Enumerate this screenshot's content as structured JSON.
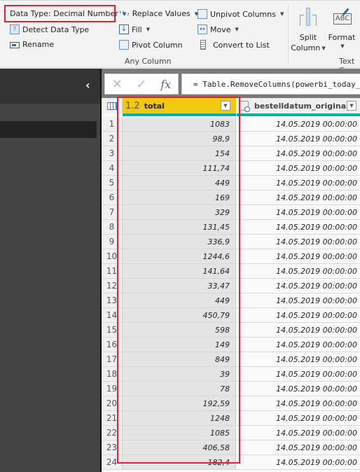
{
  "ribbon": {
    "data_type_label": "Data Type: Decimal Number",
    "detect_data_type": "Detect Data Type",
    "rename": "Rename",
    "replace_values": "Replace Values",
    "fill": "Fill",
    "pivot_column": "Pivot Column",
    "unpivot_columns": "Unpivot Columns",
    "move": "Move",
    "convert_to_list": "Convert to List",
    "group_any_column": "Any Column",
    "split_column_line1": "Split",
    "split_column_line2": "Column",
    "format": "Format",
    "group_text_column": "Text C",
    "highlight_color": "#e02230"
  },
  "formula_bar": {
    "cancel_icon": "✕",
    "commit_icon": "✓",
    "fx_label": "fx",
    "formula": "= Table.RemoveColumns(powerbi_today_"
  },
  "sidebar": {
    "collapse_icon": "‹"
  },
  "grid": {
    "columns": [
      {
        "type_label": "1.2",
        "name": "total",
        "header_color": "#f2c811"
      },
      {
        "type_label": "datetime",
        "name": "bestelldatum_original"
      }
    ],
    "rows": [
      {
        "n": "1",
        "total": "1083",
        "date": "14.05.2019 00:00:00"
      },
      {
        "n": "2",
        "total": "98,9",
        "date": "14.05.2019 00:00:00"
      },
      {
        "n": "3",
        "total": "154",
        "date": "14.05.2019 00:00:00"
      },
      {
        "n": "4",
        "total": "111,74",
        "date": "14.05.2019 00:00:00"
      },
      {
        "n": "5",
        "total": "449",
        "date": "14.05.2019 00:00:00"
      },
      {
        "n": "6",
        "total": "169",
        "date": "14.05.2019 00:00:00"
      },
      {
        "n": "7",
        "total": "329",
        "date": "14.05.2019 00:00:00"
      },
      {
        "n": "8",
        "total": "131,45",
        "date": "14.05.2019 00:00:00"
      },
      {
        "n": "9",
        "total": "336,9",
        "date": "14.05.2019 00:00:00"
      },
      {
        "n": "10",
        "total": "1244,6",
        "date": "14.05.2019 00:00:00"
      },
      {
        "n": "11",
        "total": "141,64",
        "date": "14.05.2019 00:00:00"
      },
      {
        "n": "12",
        "total": "33,47",
        "date": "14.05.2019 00:00:00"
      },
      {
        "n": "13",
        "total": "449",
        "date": "14.05.2019 00:00:00"
      },
      {
        "n": "14",
        "total": "450,79",
        "date": "14.05.2019 00:00:00"
      },
      {
        "n": "15",
        "total": "598",
        "date": "14.05.2019 00:00:00"
      },
      {
        "n": "16",
        "total": "149",
        "date": "14.05.2019 00:00:00"
      },
      {
        "n": "17",
        "total": "849",
        "date": "14.05.2019 00:00:00"
      },
      {
        "n": "18",
        "total": "39",
        "date": "14.05.2019 00:00:00"
      },
      {
        "n": "19",
        "total": "78",
        "date": "14.05.2019 00:00:00"
      },
      {
        "n": "20",
        "total": "192,59",
        "date": "14.05.2019 00:00:00"
      },
      {
        "n": "21",
        "total": "1248",
        "date": "14.05.2019 00:00:00"
      },
      {
        "n": "22",
        "total": "1085",
        "date": "14.05.2019 00:00:00"
      },
      {
        "n": "23",
        "total": "406,58",
        "date": "14.05.2019 00:00:00"
      },
      {
        "n": "24",
        "total": "182,4",
        "date": "14.05.2019 00:00:00"
      }
    ]
  }
}
